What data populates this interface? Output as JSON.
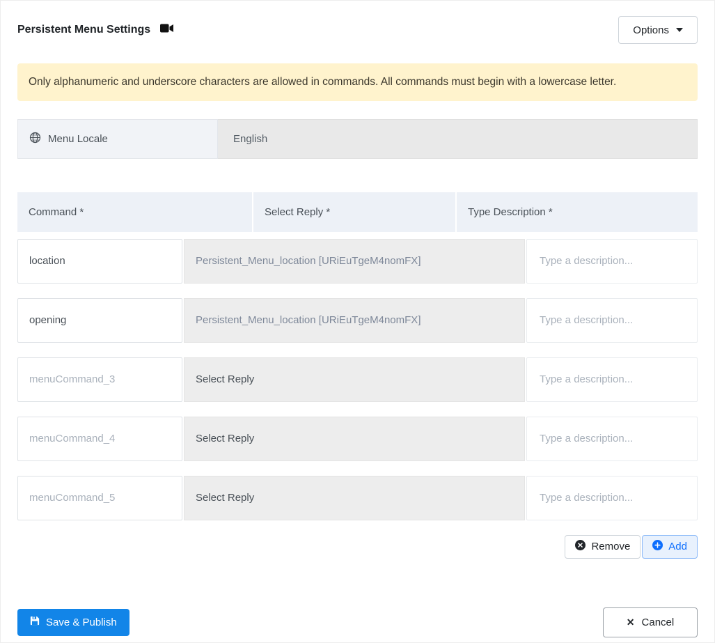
{
  "header": {
    "title": "Persistent Menu Settings",
    "options_label": "Options"
  },
  "alert": {
    "text": "Only alphanumeric and underscore characters are allowed in commands. All commands must begin with a lowercase letter."
  },
  "locale": {
    "label": "Menu Locale",
    "value": "English"
  },
  "table": {
    "headers": [
      "Command *",
      "Select Reply *",
      "Type Description *"
    ],
    "rows": [
      {
        "command_value": "location",
        "reply": "Persistent_Menu_location [URiEuTgeM4nomFX]",
        "reply_state": "filled",
        "description_placeholder": "Type a description..."
      },
      {
        "command_value": "opening",
        "reply": "Persistent_Menu_location [URiEuTgeM4nomFX]",
        "reply_state": "filled",
        "description_placeholder": "Type a description..."
      },
      {
        "command_placeholder": "menuCommand_3",
        "reply": "Select Reply",
        "reply_state": "empty",
        "description_placeholder": "Type a description..."
      },
      {
        "command_placeholder": "menuCommand_4",
        "reply": "Select Reply",
        "reply_state": "empty",
        "description_placeholder": "Type a description..."
      },
      {
        "command_placeholder": "menuCommand_5",
        "reply": "Select Reply",
        "reply_state": "empty",
        "description_placeholder": "Type a description..."
      }
    ]
  },
  "actions": {
    "remove_label": "Remove",
    "add_label": "Add"
  },
  "footer": {
    "save_label": "Save & Publish",
    "cancel_label": "Cancel"
  },
  "icons": {
    "title_icon": "video-camera-icon",
    "locale_icon": "globe-icon",
    "remove_icon": "x-circle-filled-icon",
    "add_icon": "plus-circle-filled-icon",
    "save_icon": "floppy-disk-icon",
    "cancel_icon": "x-icon",
    "options_icon": "chevron-down-icon"
  },
  "colors": {
    "primary_blue": "#1285e8",
    "add_accent": "#0d6efd",
    "add_bg": "#e8f1fd",
    "alert_bg": "#fff3cd",
    "header_bg": "#edf1f7",
    "reply_bg": "#ededed",
    "locale_label_bg": "#f1f3f7",
    "locale_value_bg": "#e9e9e9"
  }
}
